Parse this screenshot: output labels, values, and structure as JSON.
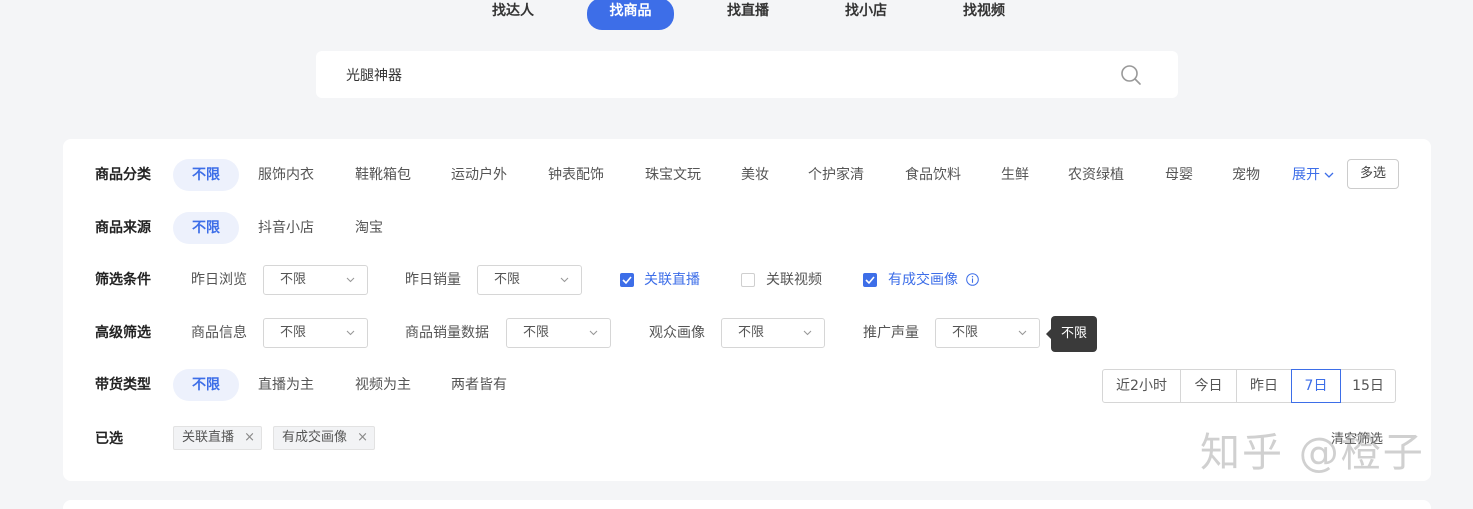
{
  "tabs": [
    {
      "label": "找达人",
      "active": false
    },
    {
      "label": "找商品",
      "active": true
    },
    {
      "label": "找直播",
      "active": false
    },
    {
      "label": "找小店",
      "active": false
    },
    {
      "label": "找视频",
      "active": false
    }
  ],
  "search": {
    "value": "光腿神器",
    "icon": "search-icon"
  },
  "category": {
    "label": "商品分类",
    "options": [
      "不限",
      "服饰内衣",
      "鞋靴箱包",
      "运动户外",
      "钟表配饰",
      "珠宝文玩",
      "美妆",
      "个护家清",
      "食品饮料",
      "生鲜",
      "农资绿植",
      "母婴",
      "宠物"
    ],
    "expand": "展开",
    "multi": "多选"
  },
  "source": {
    "label": "商品来源",
    "options": [
      "不限",
      "抖音小店",
      "淘宝"
    ]
  },
  "conditions": {
    "label": "筛选条件",
    "yesterday_views": {
      "label": "昨日浏览",
      "value": "不限"
    },
    "yesterday_sales": {
      "label": "昨日销量",
      "value": "不限"
    },
    "linked_live": {
      "label": "关联直播",
      "checked": true
    },
    "linked_video": {
      "label": "关联视频",
      "checked": false
    },
    "has_portrait": {
      "label": "有成交画像",
      "checked": true
    }
  },
  "advanced": {
    "label": "高级筛选",
    "product_info": {
      "label": "商品信息",
      "value": "不限"
    },
    "sales_data": {
      "label": "商品销量数据",
      "value": "不限"
    },
    "audience": {
      "label": "观众画像",
      "value": "不限"
    },
    "promo_volume": {
      "label": "推广声量",
      "value": "不限"
    },
    "tooltip": "不限"
  },
  "delivery": {
    "label": "带货类型",
    "options": [
      "不限",
      "直播为主",
      "视频为主",
      "两者皆有"
    ],
    "time_ranges": [
      "近2小时",
      "今日",
      "昨日",
      "7日",
      "15日"
    ],
    "active_time": "7日"
  },
  "selected": {
    "label": "已选",
    "tags": [
      "关联直播",
      "有成交画像"
    ],
    "remove": "×",
    "clear": "清空筛选"
  },
  "watermark": "知乎 @橙子",
  "colors": {
    "accent": "#3d6ee8",
    "background": "#f4f5f7"
  }
}
